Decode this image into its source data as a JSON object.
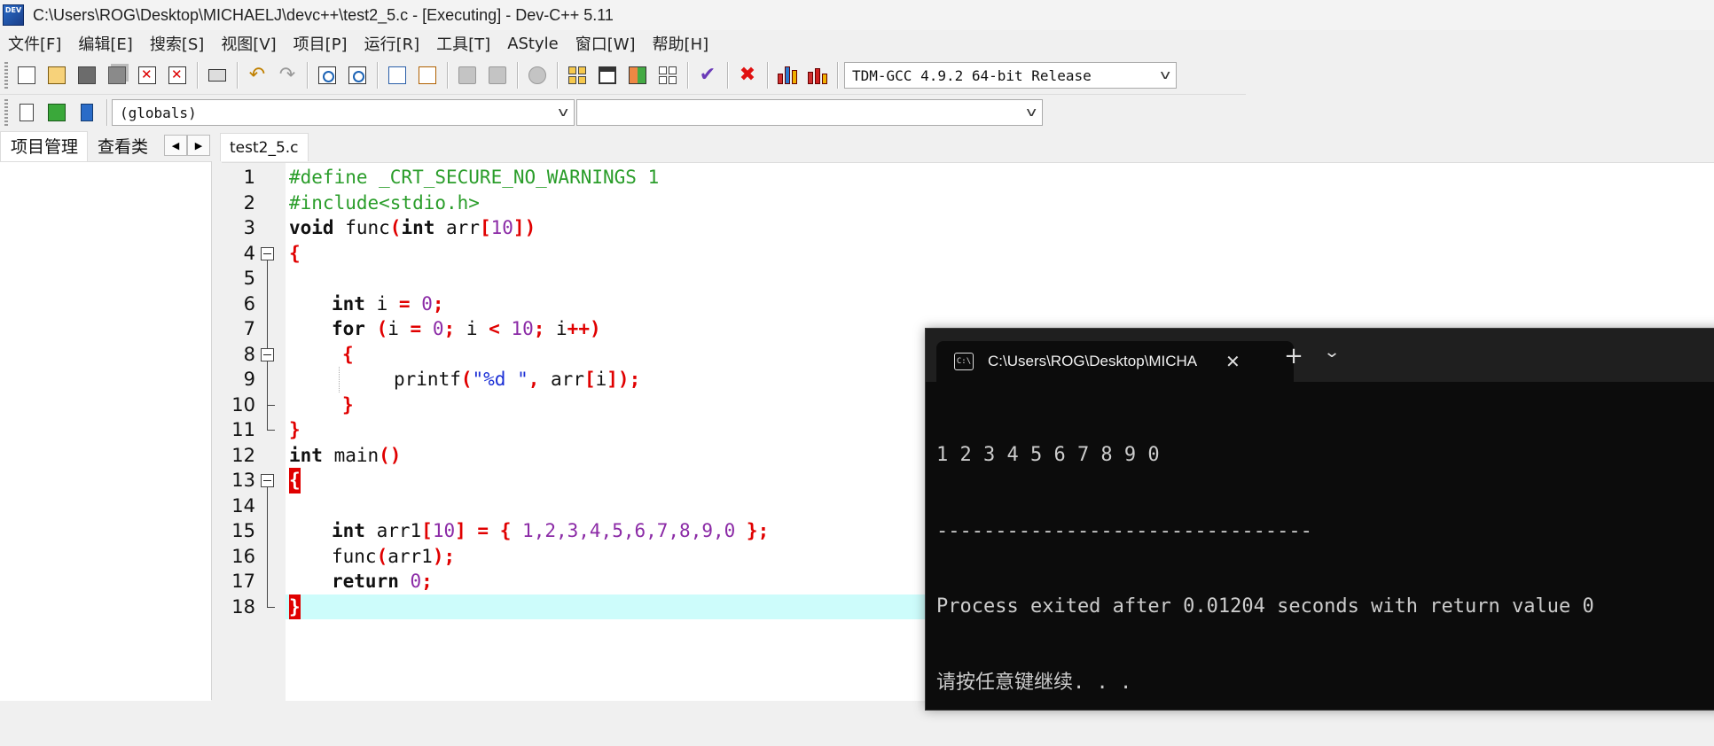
{
  "window": {
    "title": "C:\\Users\\ROG\\Desktop\\MICHAELJ\\devc++\\test2_5.c - [Executing] - Dev-C++ 5.11",
    "icon_text": "DEV"
  },
  "menu": [
    "文件[F]",
    "编辑[E]",
    "搜索[S]",
    "视图[V]",
    "项目[P]",
    "运行[R]",
    "工具[T]",
    "AStyle",
    "窗口[W]",
    "帮助[H]"
  ],
  "toolbar": {
    "compiler": "TDM-GCC 4.9.2 64-bit Release",
    "scope": "(globals)",
    "member": ""
  },
  "left_panel": {
    "tabs": [
      "项目管理",
      "查看类"
    ],
    "nav_prev": "◀",
    "nav_next": "▶"
  },
  "editor": {
    "tab": "test2_5.c",
    "lines": [
      {
        "n": "1"
      },
      {
        "n": "2"
      },
      {
        "n": "3"
      },
      {
        "n": "4"
      },
      {
        "n": "5"
      },
      {
        "n": "6"
      },
      {
        "n": "7"
      },
      {
        "n": "8"
      },
      {
        "n": "9"
      },
      {
        "n": "10"
      },
      {
        "n": "11"
      },
      {
        "n": "12"
      },
      {
        "n": "13"
      },
      {
        "n": "14"
      },
      {
        "n": "15"
      },
      {
        "n": "16"
      },
      {
        "n": "17"
      },
      {
        "n": "18"
      }
    ],
    "code": {
      "l1": "#define _CRT_SECURE_NO_WARNINGS 1",
      "l2": "#include<stdio.h>",
      "l3a": "void",
      "l3b": " func",
      "l3c": "(",
      "l3d": "int",
      "l3e": " arr",
      "l3f": "[",
      "l3g": "10",
      "l3h": "])",
      "l4": "{",
      "l6a": "int",
      "l6b": " i ",
      "l6c": "=",
      "l6d": " ",
      "l6e": "0",
      "l6f": ";",
      "l7a": "for",
      "l7b": " ",
      "l7c": "(",
      "l7d": "i ",
      "l7e": "=",
      "l7f": " ",
      "l7g": "0",
      "l7h": ";",
      "l7i": " i ",
      "l7j": "<",
      "l7k": " ",
      "l7l": "10",
      "l7m": ";",
      "l7n": " i",
      "l7o": "++)",
      "l8": "{",
      "l9a": "printf",
      "l9b": "(",
      "l9c": "\"%d \"",
      "l9d": ",",
      "l9e": " arr",
      "l9f": "[",
      "l9g": "i",
      "l9h": "]);",
      "l10": "}",
      "l11": "}",
      "l12a": "int",
      "l12b": " main",
      "l12c": "()",
      "l13": "{",
      "l15a": "int",
      "l15b": " arr1",
      "l15c": "[",
      "l15d": "10",
      "l15e": "]",
      "l15f": " ",
      "l15g": "=",
      "l15h": " ",
      "l15i": "{",
      "l15j": " ",
      "l15k": "1,2,3,4,5,6,7,8,9,0",
      "l15l": " ",
      "l15m": "};",
      "l16a": "func",
      "l16b": "(",
      "l16c": "arr1",
      "l16d": ");",
      "l17a": "return",
      "l17b": " ",
      "l17c": "0",
      "l17d": ";",
      "l18": "}"
    }
  },
  "console": {
    "title": "C:\\Users\\ROG\\Desktop\\MICHA",
    "icon_text": "C:\\",
    "close": "✕",
    "plus": "+",
    "dropdown": "⌄",
    "output": [
      "1 2 3 4 5 6 7 8 9 0",
      "--------------------------------",
      "Process exited after 0.01204 seconds with return value 0",
      "请按任意键继续. . ."
    ]
  },
  "colors": {
    "preprocessor": "#2a9d2a",
    "operator": "#e00000",
    "number": "#8b2aa6",
    "string": "#1b2fd6",
    "current_line": "#cdfcfb"
  }
}
